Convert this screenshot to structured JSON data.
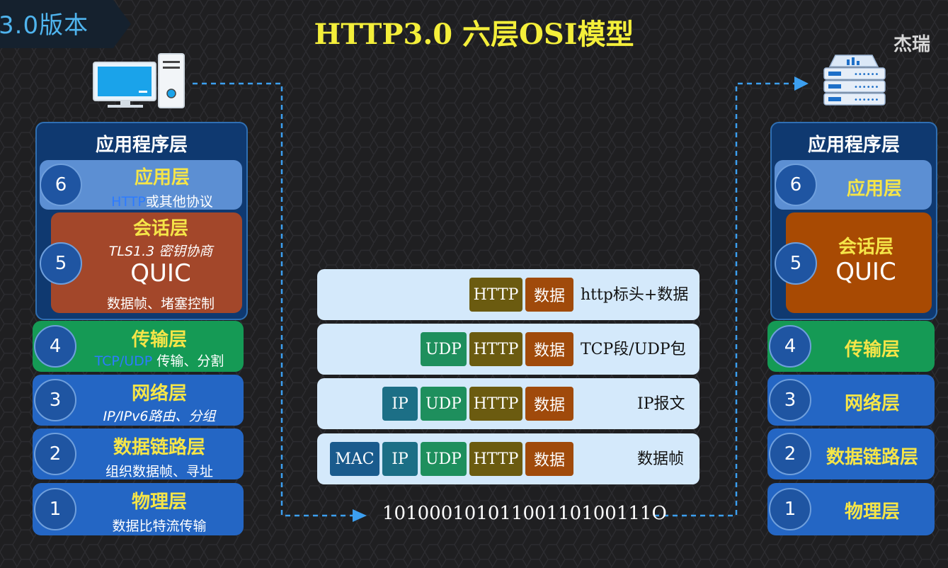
{
  "header": {
    "version_label": "3.0版本",
    "title": "HTTP3.0 六层OSI模型",
    "brand": "杰瑞"
  },
  "colors": {
    "title": "#f4ef3a",
    "layer_name": "#f5e548",
    "layer_blue": "#2466c4",
    "session_left": "#a3472a",
    "session_right": "#a84a03",
    "transport": "#159a55",
    "flow_line": "#3c9ff0"
  },
  "icons": {
    "client": "desktop-computer-icon",
    "server": "server-icon"
  },
  "client_stack": {
    "group_title": "应用程序层",
    "layers": [
      {
        "num": "6",
        "name": "应用层",
        "desc_highlight": "HTTP",
        "desc": "或其他协议"
      },
      {
        "num": "5",
        "name": "会话层",
        "desc": "TLS1.3 密钥协商",
        "protocol": "QUIC",
        "desc2": "数据帧、堵塞控制"
      },
      {
        "num": "4",
        "name": "传输层",
        "desc_highlight": "TCP/UDP",
        "desc": " 传输、分割"
      },
      {
        "num": "3",
        "name": "网络层",
        "desc": "IP/IPv6路由、分组"
      },
      {
        "num": "2",
        "name": "数据链路层",
        "desc": "组织数据帧、寻址"
      },
      {
        "num": "1",
        "name": "物理层",
        "desc": "数据比特流传输"
      }
    ]
  },
  "server_stack": {
    "group_title": "应用程序层",
    "layers": [
      {
        "num": "6",
        "name": "应用层"
      },
      {
        "num": "5",
        "name": "会话层",
        "protocol": "QUIC"
      },
      {
        "num": "4",
        "name": "传输层"
      },
      {
        "num": "3",
        "name": "网络层"
      },
      {
        "num": "2",
        "name": "数据链路层"
      },
      {
        "num": "1",
        "name": "物理层"
      }
    ]
  },
  "packets": [
    {
      "cells": [
        "HTTP",
        "数据"
      ],
      "label": "http标头+数据"
    },
    {
      "cells": [
        "UDP",
        "HTTP",
        "数据"
      ],
      "label": "TCP段/UDP包"
    },
    {
      "cells": [
        "IP",
        "UDP",
        "HTTP",
        "数据"
      ],
      "label": "IP报文"
    },
    {
      "cells": [
        "MAC",
        "IP",
        "UDP",
        "HTTP",
        "数据"
      ],
      "label": "数据帧"
    }
  ],
  "binary": "10100010101100110100111O"
}
